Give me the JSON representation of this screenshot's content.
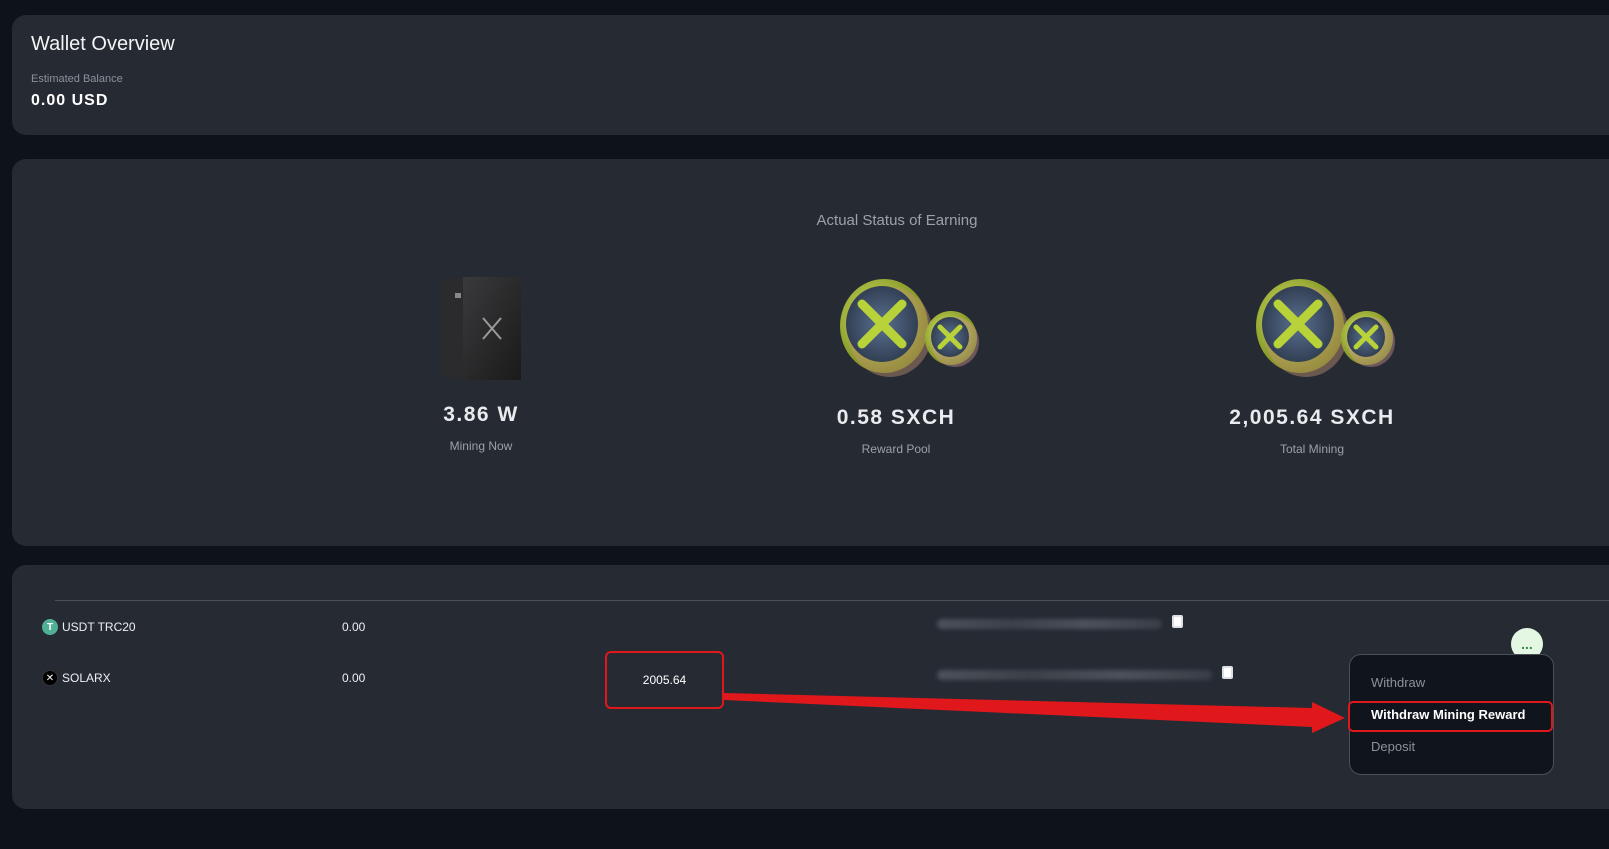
{
  "overview": {
    "title": "Wallet Overview",
    "balance_label": "Estimated Balance",
    "balance_value": "0.00 USD"
  },
  "status": {
    "heading": "Actual Status of Earning",
    "stats": [
      {
        "value": "3.86 W",
        "label": "Mining Now",
        "icon": "miner-device-icon"
      },
      {
        "value": "0.58 SXCH",
        "label": "Reward Pool",
        "icon": "coins-icon"
      },
      {
        "value": "2,005.64 SXCH",
        "label": "Total Mining",
        "icon": "coins-icon"
      }
    ]
  },
  "assets": {
    "rows": [
      {
        "name": "USDT TRC20",
        "balance": "0.00",
        "icon_glyph": "T",
        "icon": "tether-icon"
      },
      {
        "name": "SOLARX",
        "balance": "0.00",
        "mining_reward": "2005.64",
        "icon_glyph": "✕",
        "icon": "solarx-icon"
      }
    ]
  },
  "menu": {
    "more_label": "...",
    "items": [
      "Withdraw",
      "Withdraw Mining Reward",
      "Deposit"
    ]
  },
  "colors": {
    "background": "#0e121a",
    "card": "#262a33",
    "highlight": "#e0181c",
    "accent_green": "#b5d33a"
  }
}
